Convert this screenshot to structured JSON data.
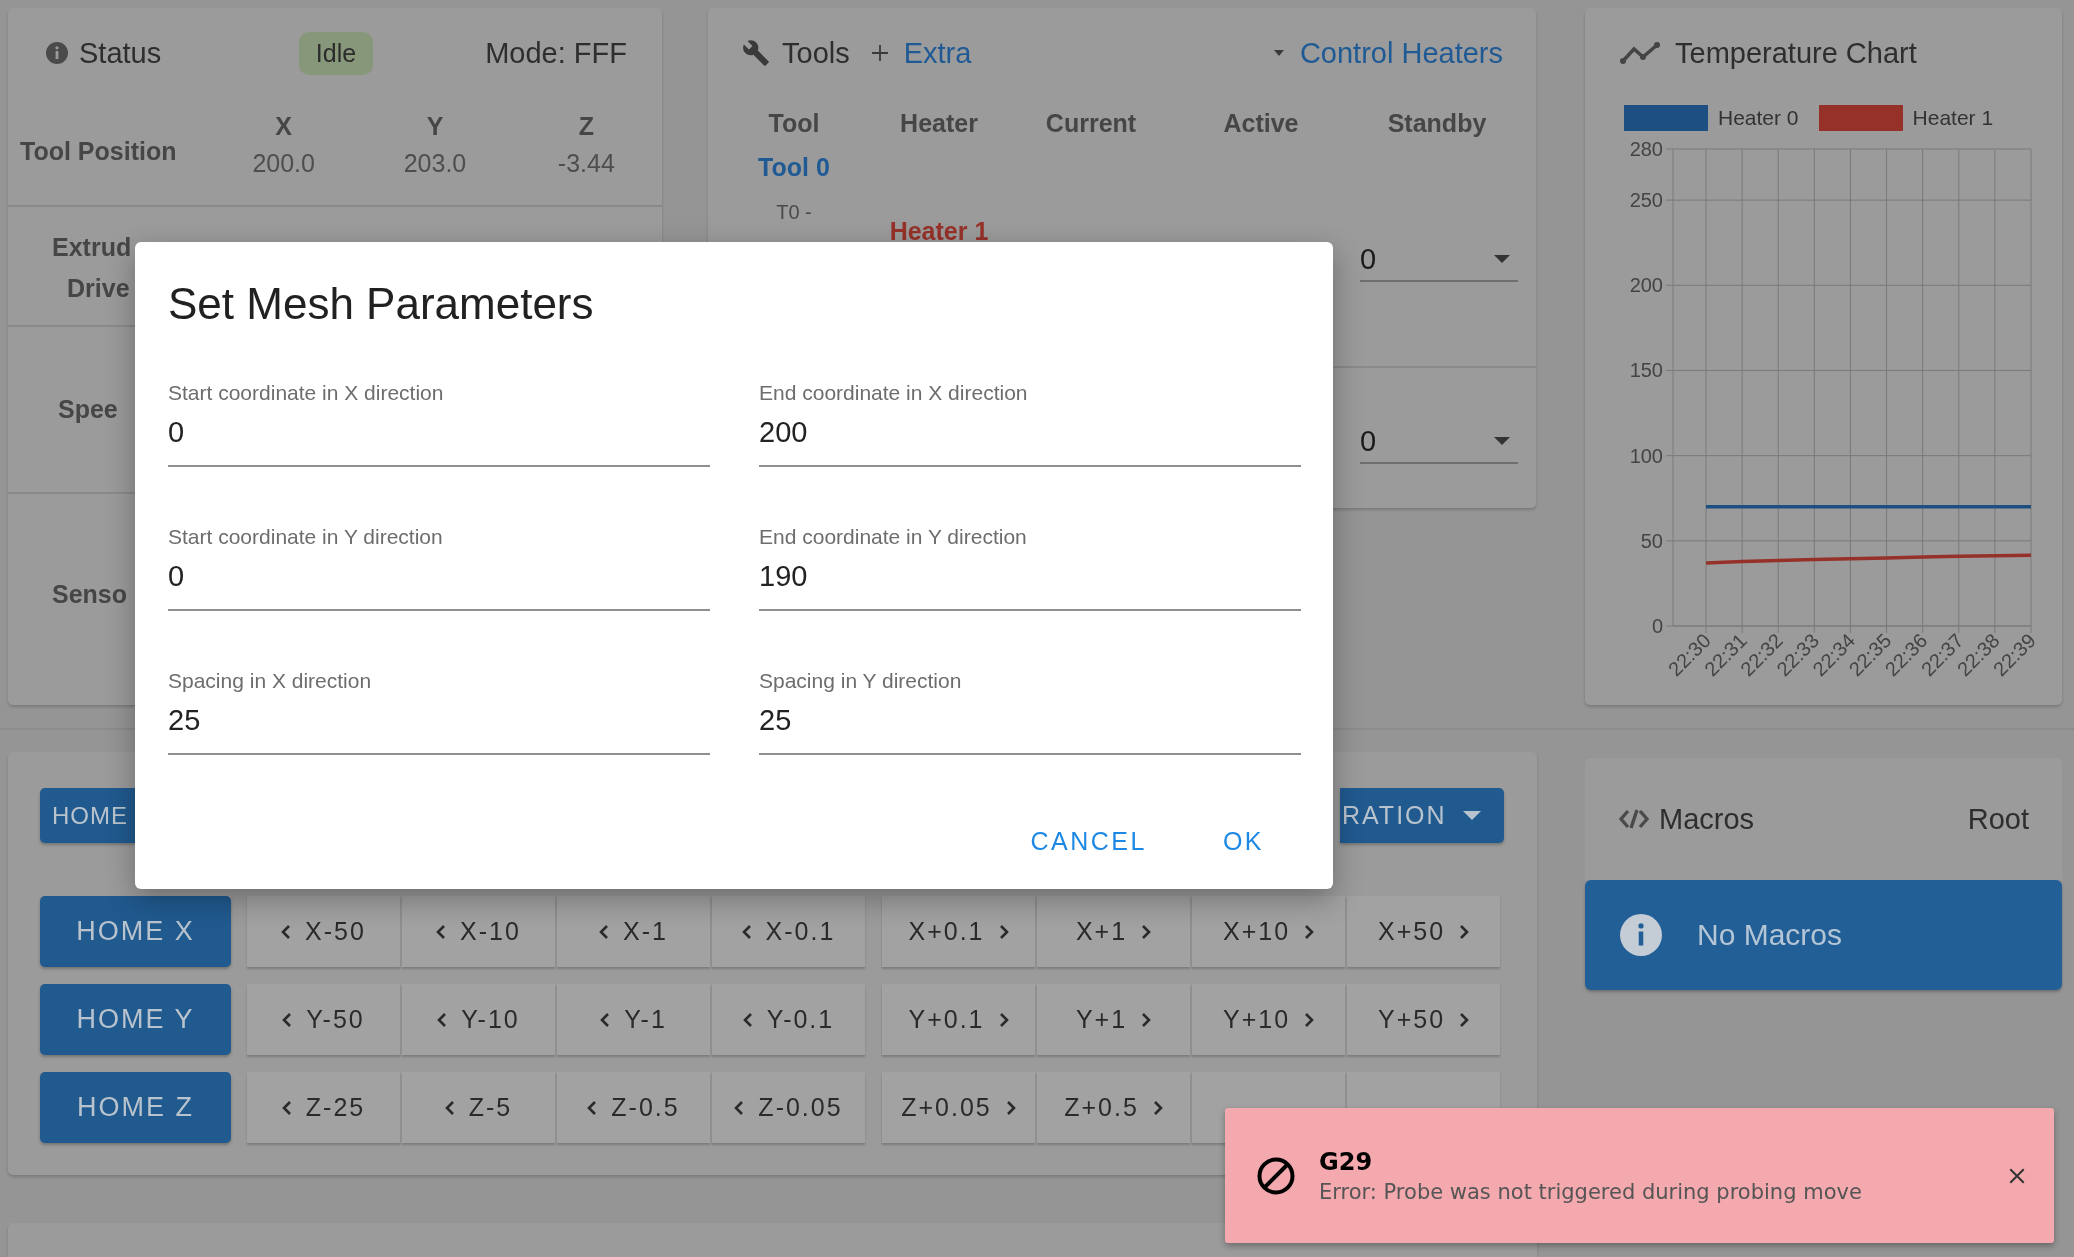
{
  "status_panel": {
    "title": "Status",
    "state": "Idle",
    "mode": "Mode: FFF",
    "position_label": "Tool Position",
    "axes": [
      {
        "name": "X",
        "value": "200.0"
      },
      {
        "name": "Y",
        "value": "203.0"
      },
      {
        "name": "Z",
        "value": "-3.44"
      }
    ],
    "rows": [
      {
        "lines": [
          "Extrud",
          "Drive"
        ]
      },
      {
        "lines": [
          "Spee"
        ]
      },
      {
        "lines": [
          "Senso"
        ]
      }
    ]
  },
  "tools_panel": {
    "title": "Tools",
    "extra": "Extra",
    "control": "Control Heaters",
    "columns": [
      "Tool",
      "Heater",
      "Current",
      "Active",
      "Standby"
    ],
    "tool": "Tool 0",
    "tool_sub": "T0 -",
    "heater": "Heater 1",
    "standby_selects": [
      {
        "value": "0"
      },
      {
        "value": "0"
      }
    ]
  },
  "chart_panel": {
    "title": "Temperature Chart",
    "chart_data": {
      "type": "line",
      "grid": true,
      "categories": [
        "22:30",
        "22:31",
        "22:32",
        "22:33",
        "22:34",
        "22:35",
        "22:36",
        "22:37",
        "22:38",
        "22:39"
      ],
      "ylim": [
        0,
        280
      ],
      "yticks": [
        0,
        50,
        100,
        150,
        200,
        250,
        280
      ],
      "series": [
        {
          "name": "Heater 0",
          "color": "#1e4f82",
          "values": [
            70,
            70,
            70,
            70,
            70,
            70,
            70,
            70,
            70,
            70
          ]
        },
        {
          "name": "Heater 1",
          "color": "#963129",
          "values": [
            37,
            37.8,
            38.5,
            39,
            39.5,
            40,
            40.5,
            41,
            41.2,
            41.5
          ]
        }
      ]
    }
  },
  "move_panel": {
    "home_all": "HOME",
    "calibration": "RATION",
    "rows": [
      {
        "home": "HOME X",
        "jogs": [
          {
            "label": "X-50",
            "kind": "minus"
          },
          {
            "label": "X-10",
            "kind": "minus"
          },
          {
            "label": "X-1",
            "kind": "minus"
          },
          {
            "label": "X-0.1",
            "kind": "minus"
          },
          {
            "label": "X+0.1",
            "kind": "plus"
          },
          {
            "label": "X+1",
            "kind": "plus"
          },
          {
            "label": "X+10",
            "kind": "plus"
          },
          {
            "label": "X+50",
            "kind": "plus"
          }
        ]
      },
      {
        "home": "HOME Y",
        "jogs": [
          {
            "label": "Y-50",
            "kind": "minus"
          },
          {
            "label": "Y-10",
            "kind": "minus"
          },
          {
            "label": "Y-1",
            "kind": "minus"
          },
          {
            "label": "Y-0.1",
            "kind": "minus"
          },
          {
            "label": "Y+0.1",
            "kind": "plus"
          },
          {
            "label": "Y+1",
            "kind": "plus"
          },
          {
            "label": "Y+10",
            "kind": "plus"
          },
          {
            "label": "Y+50",
            "kind": "plus"
          }
        ]
      },
      {
        "home": "HOME Z",
        "jogs": [
          {
            "label": "Z-25",
            "kind": "minus"
          },
          {
            "label": "Z-5",
            "kind": "minus"
          },
          {
            "label": "Z-0.5",
            "kind": "minus"
          },
          {
            "label": "Z-0.05",
            "kind": "minus"
          },
          {
            "label": "Z+0.05",
            "kind": "plus"
          },
          {
            "label": "Z+0.5",
            "kind": "plus"
          },
          {
            "kind": "covered"
          },
          {
            "kind": "covered"
          }
        ]
      }
    ]
  },
  "macros_panel": {
    "title": "Macros",
    "path": "Root",
    "empty_message": "No Macros"
  },
  "dialog": {
    "title": "Set Mesh Parameters",
    "fields": [
      {
        "label": "Start coordinate in X direction",
        "value": "0"
      },
      {
        "label": "End coordinate in X direction",
        "value": "200"
      },
      {
        "label": "Start coordinate in Y direction",
        "value": "0"
      },
      {
        "label": "End coordinate in Y direction",
        "value": "190"
      },
      {
        "label": "Spacing in X direction",
        "value": "25"
      },
      {
        "label": "Spacing in Y direction",
        "value": "25"
      }
    ],
    "buttons": [
      "CANCEL",
      "OK"
    ]
  },
  "toast": {
    "code": "G29",
    "message": "Error: Probe was not triggered during probing move"
  }
}
